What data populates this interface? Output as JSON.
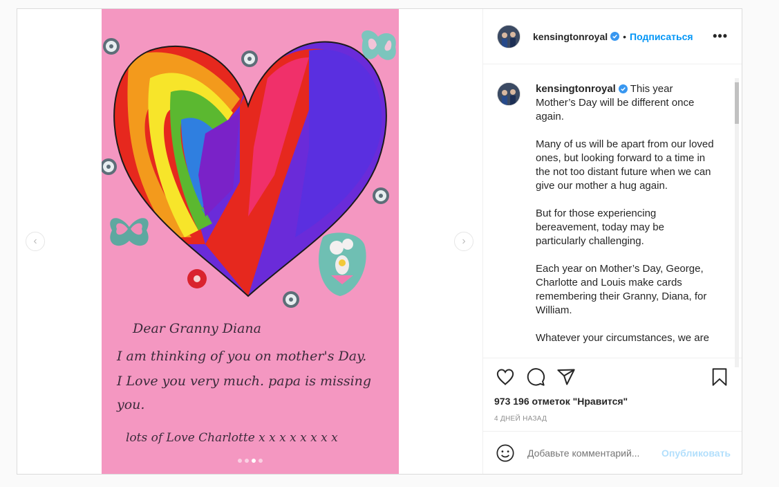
{
  "post": {
    "username": "kensingtonroyal",
    "follow_label": "Подписаться",
    "separator": "•",
    "more_label": "•••",
    "caption": "This year Mother’s Day will be different once again.\n\nMany of us will be apart from our loved ones, but looking forward to a time in the not too distant future when we can give our mother a hug again.\n\nBut for those experiencing bereavement, today may be particularly challenging.\n\nEach year on Mother’s Day, George, Charlotte and Louis make cards remembering their Granny, Diana, for William.\n\nWhatever your circumstances, we are",
    "likes": "973 196 отметок \"Нравится\"",
    "date": "4 ДНЕЙ НАЗАД",
    "comment_placeholder": "Добавьте комментарий...",
    "publish_label": "Опубликовать"
  },
  "card": {
    "line1": "Dear Granny Diana",
    "line2": "I am thinking of you on mother's Day.",
    "line3": "I Love you very much. papa is missing",
    "line4": "you.",
    "line5": "lots of Love Charlotte x x x x x x x x"
  },
  "carousel": {
    "slide_count": 4,
    "active_slide": 3,
    "prev_label": "‹",
    "next_label": "›"
  },
  "icons": {
    "like": "heart-icon",
    "comment": "comment-icon",
    "share": "share-icon",
    "save": "bookmark-icon",
    "emoji": "emoji-icon"
  },
  "colors": {
    "accent": "#0095f6",
    "card_bg": "#f497c1",
    "publish_disabled": "#b2dffc"
  }
}
